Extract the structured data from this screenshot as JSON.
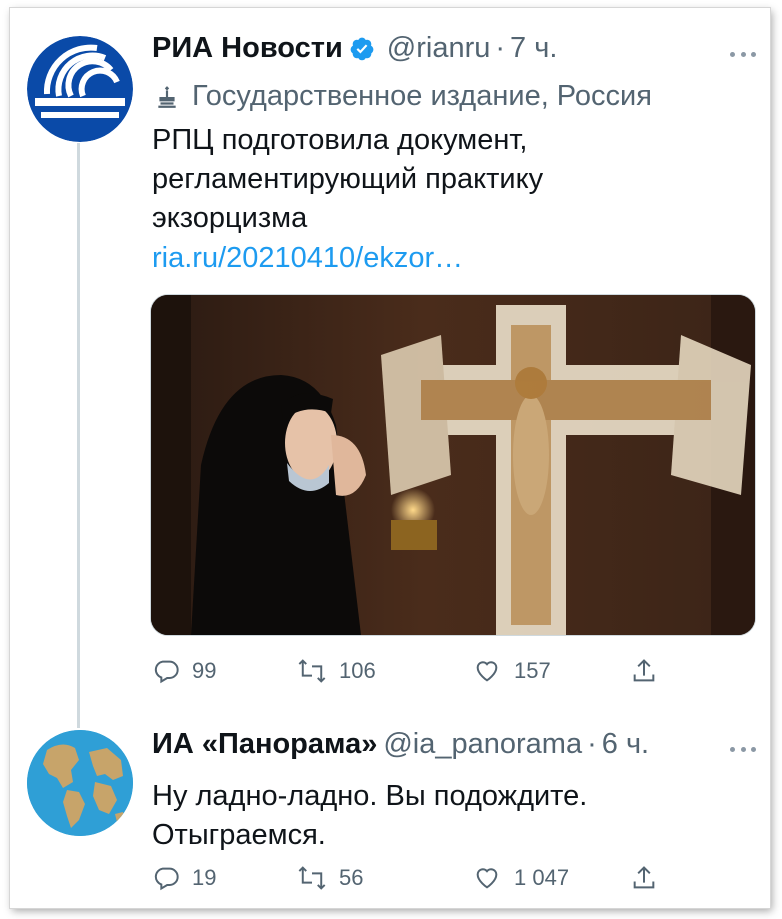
{
  "tweets": [
    {
      "name": "РИА Новости",
      "handle": "@rianru",
      "time": "7 ч.",
      "label": "Государственное издание, Россия",
      "text": "РПЦ подготовила документ,\nрегламентирующий практику\nэкзорцизма",
      "link": "ria.ru/20210410/ekzor…",
      "actions": {
        "replies": "99",
        "retweets": "106",
        "likes": "157"
      }
    },
    {
      "name": "ИА «Панорама»",
      "handle": "@ia_panorama",
      "time": "6 ч.",
      "text": "Ну ладно-ладно. Вы подождите.\nОтыграемся.",
      "actions": {
        "replies": "19",
        "retweets": "56",
        "likes": "1 047"
      }
    }
  ],
  "separator": "·",
  "colors": {
    "text": "#0f1419",
    "secondary": "#536471",
    "link": "#1d9bf0",
    "verified": "#1d9bf0",
    "ria_blue": "#0a4aa8"
  },
  "icons": [
    "verified-badge-icon",
    "state-media-icon",
    "reply-icon",
    "retweet-icon",
    "like-icon",
    "share-icon",
    "more-icon"
  ]
}
